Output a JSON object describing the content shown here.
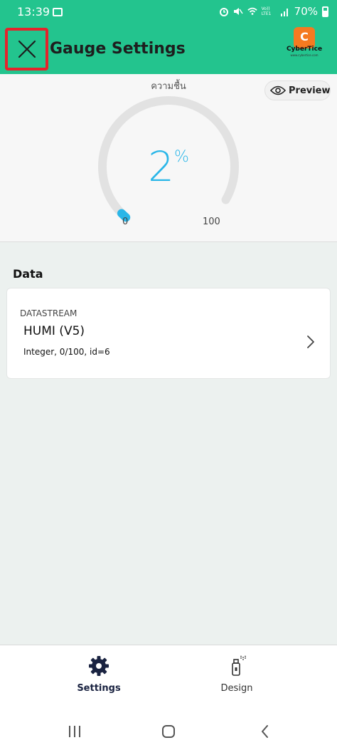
{
  "status_bar": {
    "time": "13:39",
    "lte_label": "Vo)) LTE1",
    "battery": "70%"
  },
  "header": {
    "title": "Gauge Settings",
    "logo_text": "CyberTice",
    "logo_subtext": "www.cybertice.com",
    "brand_color": "#23c48e"
  },
  "preview": {
    "gauge_label": "ความชื้น",
    "preview_button": "Preview",
    "value": "2",
    "unit": "%",
    "min": "0",
    "max": "100",
    "value_fraction": 0.02,
    "accent_color": "#29b6e8"
  },
  "data_section": {
    "title": "Data",
    "card": {
      "caption": "DATASTREAM",
      "name": "HUMI (V5)",
      "meta": "Integer, 0/100, id=6"
    }
  },
  "bottom_nav": {
    "tabs": [
      {
        "label": "Settings",
        "icon": "gear-icon",
        "active": true
      },
      {
        "label": "Design",
        "icon": "spray-can-icon",
        "active": false
      }
    ]
  },
  "system_nav": {
    "buttons": [
      "recents-icon",
      "home-icon",
      "back-icon"
    ]
  }
}
